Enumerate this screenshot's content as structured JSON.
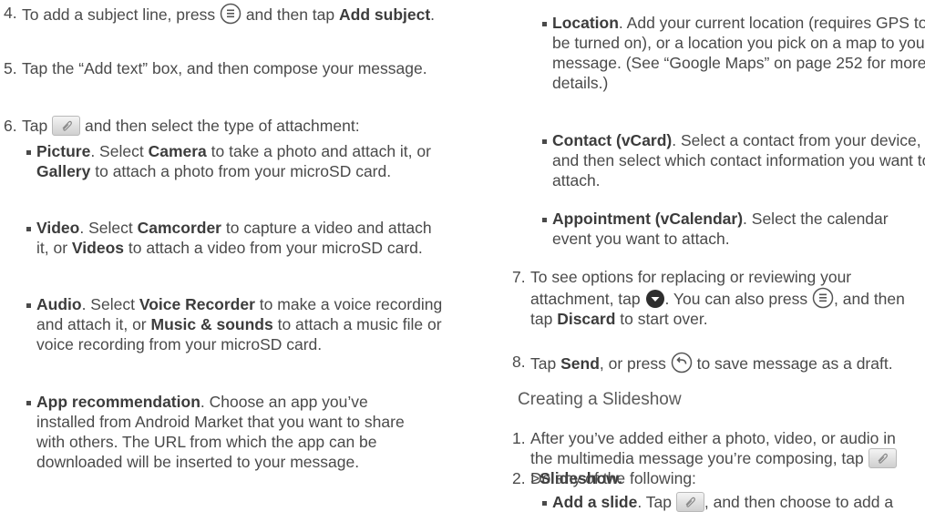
{
  "colors": {
    "text": "#4a4a4a",
    "bold": "#3c3c3c",
    "background": "#ffffff"
  },
  "icons": {
    "menu": "menu-key-icon",
    "attach": "paperclip-icon",
    "expand": "expand-arrow-icon",
    "back": "back-key-icon"
  },
  "left": {
    "s4": {
      "num": "4.",
      "a": "To add a subject line, press",
      "b": "and then tap",
      "bold": "Add subject",
      "end": "."
    },
    "s5": {
      "num": "5.",
      "text": "Tap the “Add text” box, and then compose your message."
    },
    "s6": {
      "num": "6.",
      "a": "Tap",
      "b": "and then select the type of attachment:"
    },
    "picture": {
      "bold": "Picture",
      "t1": ". Select",
      "b1": "Camera",
      "t2": "to take a photo and attach it, or",
      "b2": "Gallery",
      "t3": "to attach a photo from your microSD card."
    },
    "video": {
      "bold": "Video",
      "t1": ". Select",
      "b1": "Camcorder",
      "t2": "to capture a video and attach it, or",
      "b2": "Videos",
      "t3": "to attach a video from your microSD card."
    },
    "audio": {
      "bold": "Audio",
      "t1": ". Select",
      "b1": "Voice Recorder",
      "t2": "to make a voice recording and attach it, or",
      "b2": "Music & sounds",
      "t3": "to attach a music file or voice recording from your microSD card."
    },
    "app": {
      "bold": "App recommendation",
      "t1": ". Choose an app you’ve installed from Android Market that you want to share with others. The URL from which the app can be downloaded will be inserted to your message."
    }
  },
  "right": {
    "location": {
      "bold": "Location",
      "t1": ". Add your current location (requires GPS to be turned on), or a location you pick on a map to your message. (See “Google Maps” on page 252 for more details.)"
    },
    "contact": {
      "bold": "Contact (vCard)",
      "t1": ". Select a contact from your device, and then select which contact information you want to attach."
    },
    "appointment": {
      "bold": "Appointment (vCalendar)",
      "t1": ". Select the calendar event you want to attach."
    },
    "s7": {
      "num": "7.",
      "a": "To see options for replacing or reviewing your attachment, tap",
      "b": ". You can also press",
      "c": ", and then tap",
      "bold": "Discard",
      "d": "to start over."
    },
    "s8": {
      "num": "8.",
      "a": "Tap",
      "bold": "Send",
      "b": ", or press",
      "c": "to save message as a draft."
    },
    "heading": "Creating a Slideshow",
    "ss1": {
      "num": "1.",
      "a": "After you’ve added either a photo, video, or audio in the multimedia message you’re composing, tap",
      "gt": ">",
      "bold": "Slideshow."
    },
    "ss2": {
      "num": "2.",
      "text": "Do any of the following:"
    },
    "slide": {
      "bold": "Add a slide",
      "t1": ". Tap",
      "t2": ", and then choose to add a"
    }
  }
}
